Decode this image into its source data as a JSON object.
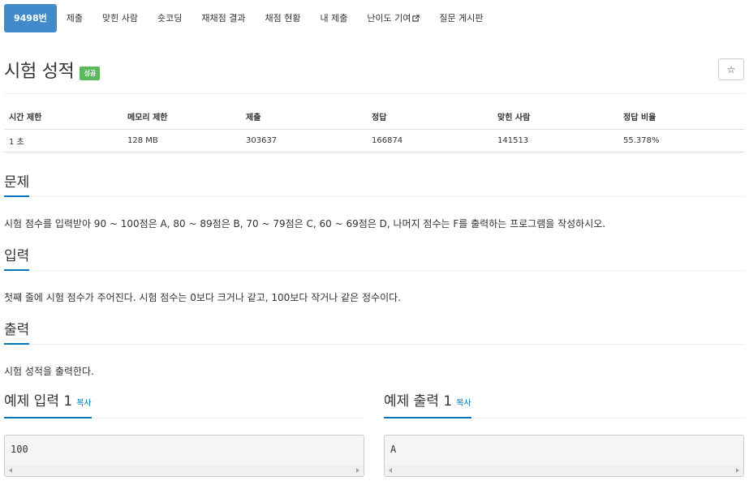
{
  "nav": {
    "items": [
      {
        "label": "9498번",
        "active": true
      },
      {
        "label": "제출"
      },
      {
        "label": "맞힌 사람"
      },
      {
        "label": "숏코딩"
      },
      {
        "label": "재채점 결과"
      },
      {
        "label": "채점 현황"
      },
      {
        "label": "내 제출"
      },
      {
        "label": "난이도 기여",
        "icon": "external-link-icon"
      },
      {
        "label": "질문 게시판"
      }
    ]
  },
  "problem": {
    "title": "시험 성적",
    "badge": "성공",
    "star_icon": "☆"
  },
  "info_table": {
    "headers": [
      "시간 제한",
      "메모리 제한",
      "제출",
      "정답",
      "맞힌 사람",
      "정답 비율"
    ],
    "values": [
      "1 초",
      "128 MB",
      "303637",
      "166874",
      "141513",
      "55.378%"
    ]
  },
  "sections": {
    "description_title": "문제",
    "description_text": "시험 점수를 입력받아 90 ~ 100점은 A, 80 ~ 89점은 B, 70 ~ 79점은 C, 60 ~ 69점은 D, 나머지 점수는 F를 출력하는 프로그램을 작성하시오.",
    "input_title": "입력",
    "input_text": "첫째 줄에 시험 점수가 주어진다. 시험 점수는 0보다 크거나 같고, 100보다 작거나 같은 정수이다.",
    "output_title": "출력",
    "output_text": "시험 성적을 출력한다."
  },
  "samples": {
    "input_title": "예제 입력 1",
    "output_title": "예제 출력 1",
    "copy_label": "복사",
    "input_value": "100",
    "output_value": "A"
  },
  "colors": {
    "active_nav": "#428bca",
    "badge_success": "#5cb85c",
    "section_underline": "#0076c0",
    "link": "#0076c0"
  }
}
